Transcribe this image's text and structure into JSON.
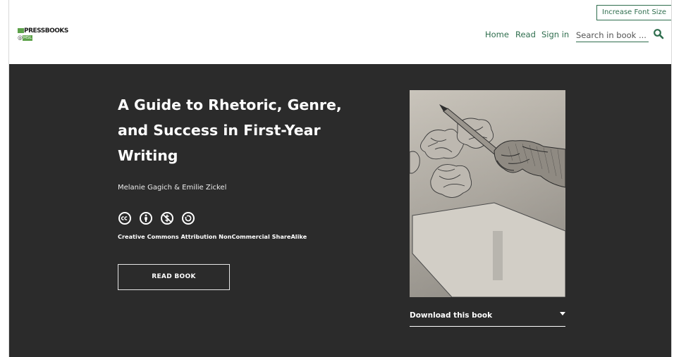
{
  "header": {
    "font_size_button": "Increase Font Size",
    "logo": {
      "text": "PRESSBOOKS",
      "at": "@",
      "sub": "MSL"
    },
    "nav": {
      "home": "Home",
      "read": "Read",
      "sign_in": "Sign in"
    },
    "search": {
      "placeholder": "Search in book ..."
    },
    "icons": {
      "search": "search-icon"
    }
  },
  "hero": {
    "title": "A Guide to Rhetoric, Genre, and Success in First-Year Writing",
    "authors": "Melanie Gagich & Emilie Zickel",
    "license_icons": [
      "cc-icon",
      "by-icon",
      "nc-icon",
      "sa-icon"
    ],
    "license": "Creative Commons Attribution NonCommercial ShareAlike",
    "read_button": "READ BOOK",
    "download_label": "Download this book"
  },
  "colors": {
    "accent": "#2f6e4e",
    "hero_bg": "#2b2b2b",
    "logo_green": "#5da24a"
  }
}
